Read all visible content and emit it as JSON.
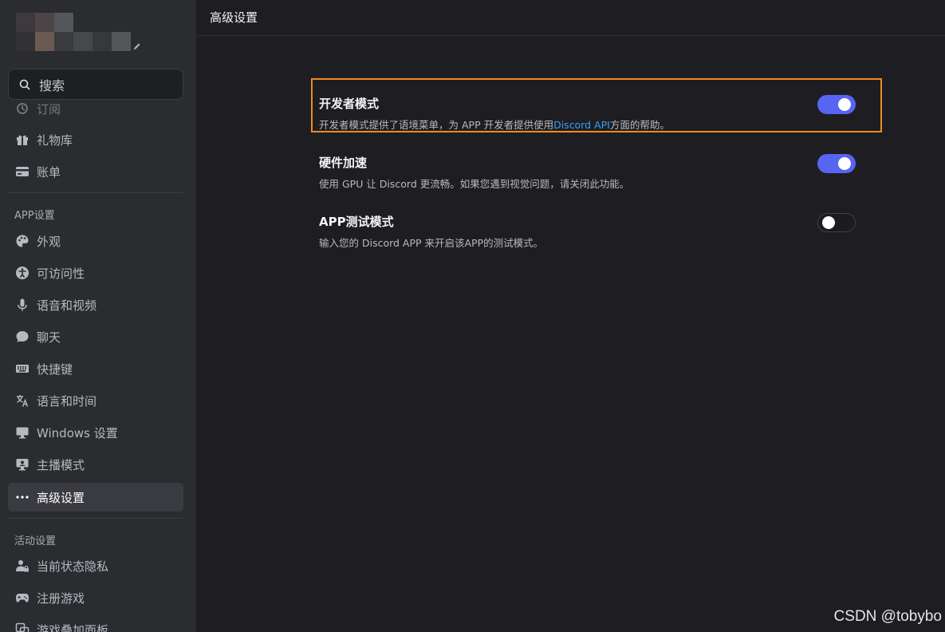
{
  "sidebar": {
    "search_placeholder": "搜索",
    "top_items": [
      {
        "label": "订阅",
        "icon": "subscription-icon"
      },
      {
        "label": "礼物库",
        "icon": "gift-icon"
      },
      {
        "label": "账单",
        "icon": "card-icon"
      }
    ],
    "app_section": "APP设置",
    "app_items": [
      {
        "label": "外观",
        "icon": "palette-icon"
      },
      {
        "label": "可访问性",
        "icon": "accessibility-icon"
      },
      {
        "label": "语音和视频",
        "icon": "microphone-icon"
      },
      {
        "label": "聊天",
        "icon": "chat-bubble-icon"
      },
      {
        "label": "快捷键",
        "icon": "keyboard-icon"
      },
      {
        "label": "语言和时间",
        "icon": "translate-icon"
      },
      {
        "label": "Windows 设置",
        "icon": "monitor-icon"
      },
      {
        "label": "主播模式",
        "icon": "streamer-icon"
      },
      {
        "label": "高级设置",
        "icon": "more-dots-icon"
      }
    ],
    "activity_section": "活动设置",
    "activity_items": [
      {
        "label": "当前状态隐私",
        "icon": "user-privacy-icon"
      },
      {
        "label": "注册游戏",
        "icon": "gamepad-icon"
      },
      {
        "label": "游戏叠加面板",
        "icon": "overlay-icon"
      }
    ]
  },
  "main": {
    "title": "高级设置",
    "settings": [
      {
        "title": "开发者模式",
        "desc_before": "开发者模式提供了语境菜单，为 APP 开发者提供使用",
        "desc_link": "Discord API",
        "desc_after": "方面的帮助。",
        "enabled": true
      },
      {
        "title": "硬件加速",
        "desc": "使用 GPU 让 Discord 更流畅。如果您遇到视觉问题，请关闭此功能。",
        "enabled": true
      },
      {
        "title": "APP测试模式",
        "desc": "输入您的 Discord APP 来开启该APP的测试模式。",
        "enabled": false
      }
    ]
  },
  "colors": {
    "accent": "#5865f2",
    "highlight": "#f08a24",
    "link": "#3d9cf5"
  },
  "watermark": "CSDN @tobybo"
}
